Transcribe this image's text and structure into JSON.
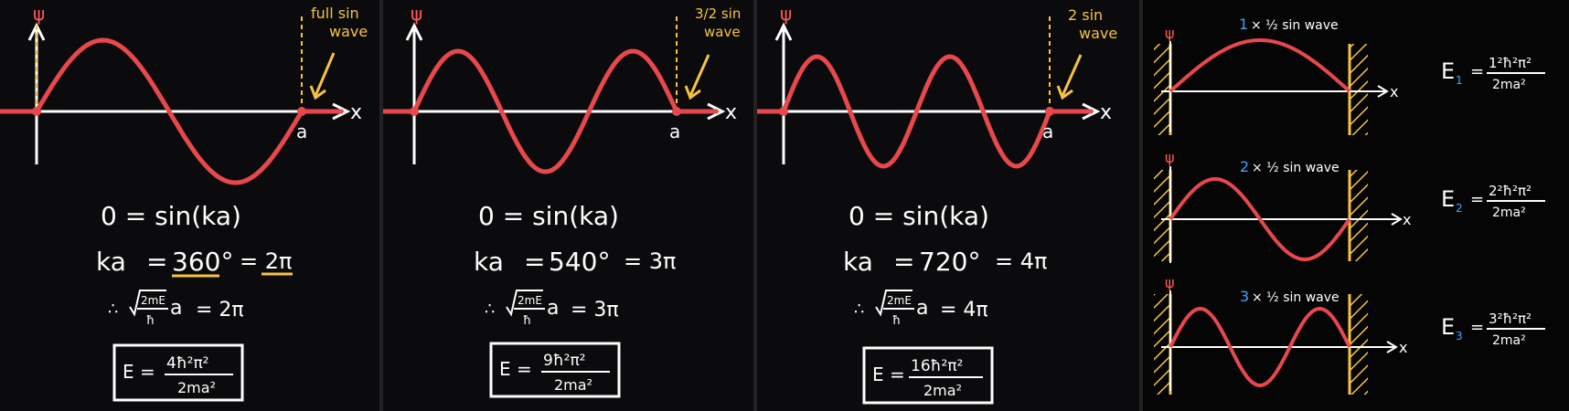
{
  "colors": {
    "wave": "#e8484c",
    "axis": "#ffffff",
    "note": "#f6c343",
    "index": "#3ea3ff",
    "background": "#000000",
    "wall": "#f6c343"
  },
  "panels": [
    {
      "psi": "ψ",
      "note_line1": "full sin",
      "note_line2": "wave",
      "x_label": "x",
      "a_label": "a",
      "eq1": "0 = sin(ka)",
      "eq2_left": "ka",
      "eq2_eq": "=",
      "eq2_deg": "360°",
      "eq2_rhs": "= 2π",
      "eq3_prefix": "∴",
      "eq3_sqrt": "2mE",
      "eq3_hbar": "ħ",
      "eq3_a": "a",
      "eq3_rhs": "= 2π",
      "box_E": "E =",
      "box_num": "4ħ²π²",
      "box_den": "2ma²"
    },
    {
      "psi": "ψ",
      "note_line1": "3/2 sin",
      "note_line2": "wave",
      "x_label": "x",
      "a_label": "a",
      "eq1": "0 = sin(ka)",
      "eq2_left": "ka",
      "eq2_eq": "=",
      "eq2_deg": "540°",
      "eq2_rhs": "= 3π",
      "eq3_prefix": "∴",
      "eq3_sqrt": "2mE",
      "eq3_hbar": "ħ",
      "eq3_a": "a",
      "eq3_rhs": "= 3π",
      "box_E": "E =",
      "box_num": "9ħ²π²",
      "box_den": "2ma²"
    },
    {
      "psi": "ψ",
      "note_line1": "2 sin",
      "note_line2": "wave",
      "x_label": "x",
      "a_label": "a",
      "eq1": "0 = sin(ka)",
      "eq2_left": "ka",
      "eq2_eq": "=",
      "eq2_deg": "720°",
      "eq2_rhs": "= 4π",
      "eq3_prefix": "∴",
      "eq3_sqrt": "2mE",
      "eq3_hbar": "ħ",
      "eq3_a": "a",
      "eq3_rhs": "= 4π",
      "box_E": "E =",
      "box_num": "16ħ²π²",
      "box_den": "2ma²"
    }
  ],
  "summary": [
    {
      "label_n": "1",
      "label_text": "× ½ sin wave",
      "x_label": "x",
      "psi": "ψ",
      "E_sym": "E",
      "E_sub": "1",
      "num": "1²ħ²π²",
      "den": "2ma²",
      "half_waves": 1
    },
    {
      "label_n": "2",
      "label_text": "× ½ sin wave",
      "x_label": "x",
      "psi": "ψ",
      "E_sym": "E",
      "E_sub": "2",
      "num": "2²ħ²π²",
      "den": "2ma²",
      "half_waves": 2
    },
    {
      "label_n": "3",
      "label_text": "× ½ sin wave",
      "x_label": "x",
      "psi": "ψ",
      "E_sym": "E",
      "E_sub": "3",
      "num": "3²ħ²π²",
      "den": "2ma²",
      "half_waves": 3
    }
  ]
}
